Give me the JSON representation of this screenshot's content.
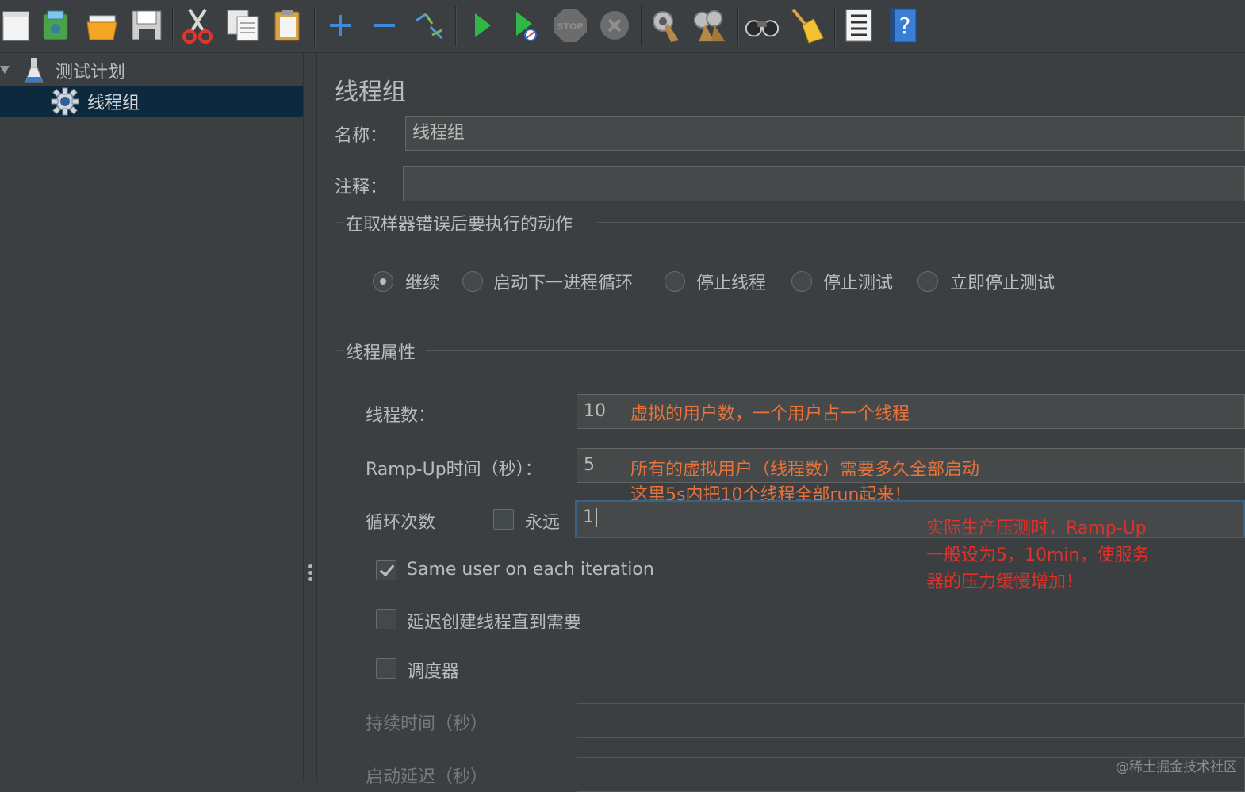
{
  "toolbar": {
    "items": [
      "new-icon",
      "templates-icon",
      "open-icon",
      "save-icon",
      "cut-icon",
      "copy-icon",
      "paste-icon",
      "expand-icon",
      "collapse-icon",
      "toggle-icon",
      "start-icon",
      "start-no-pauses-icon",
      "stop-icon",
      "shutdown-icon",
      "clear-icon",
      "clear-all-icon",
      "search-icon",
      "reset-search-icon",
      "function-helper-icon",
      "help-icon"
    ],
    "stop_text": "STOP"
  },
  "tree": {
    "root_label": "测试计划",
    "child_label": "线程组"
  },
  "panel": {
    "title": "线程组",
    "name_label": "名称：",
    "name_value": "线程组",
    "comment_label": "注释：",
    "comment_value": "",
    "error_group_title": "在取样器错误后要执行的动作",
    "error_actions": [
      {
        "label": "继续",
        "selected": true
      },
      {
        "label": "启动下一进程循环",
        "selected": false
      },
      {
        "label": "停止线程",
        "selected": false
      },
      {
        "label": "停止测试",
        "selected": false
      },
      {
        "label": "立即停止测试",
        "selected": false
      }
    ],
    "thread_group_title": "线程属性",
    "threads_label": "线程数：",
    "threads_value": "10",
    "rampup_label": "Ramp-Up时间（秒）：",
    "rampup_value": "5",
    "loop_label": "循环次数",
    "forever_label": "永远",
    "forever_checked": false,
    "loop_value": "1",
    "same_user_label": "Same user on each iteration",
    "same_user_checked": true,
    "delay_label": "延迟创建线程直到需要",
    "delay_checked": false,
    "scheduler_label": "调度器",
    "scheduler_checked": false,
    "duration_label": "持续时间（秒）",
    "duration_value": "",
    "startup_delay_label": "启动延迟（秒）",
    "startup_delay_value": ""
  },
  "annotations": {
    "threads_note": "虚拟的用户数，一个用户占一个线程",
    "rampup_note_1": "所有的虚拟用户（线程数）需要多久全部启动",
    "rampup_note_2": "这里5s内把10个线程全部run起来！",
    "red_note_1": "实际生产压测时，Ramp-Up",
    "red_note_2": "一般设为5，10min，使服务",
    "red_note_3": "器的压力缓慢增加！"
  },
  "watermark": "@稀土掘金技术社区",
  "colors": {
    "background": "#3c3f41",
    "selection": "#0d293e",
    "annotation_orange": "#e8733a",
    "annotation_red": "#e0322a",
    "focus_border": "#3d6185"
  }
}
